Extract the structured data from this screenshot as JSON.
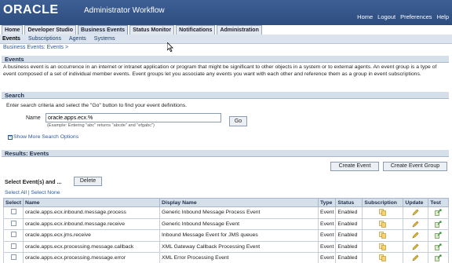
{
  "header": {
    "logo": "ORACLE",
    "app_title": "Administrator Workflow",
    "links": [
      "Home",
      "Logout",
      "Preferences",
      "Help"
    ]
  },
  "tabs": [
    {
      "label": "Home",
      "active": false
    },
    {
      "label": "Developer Studio",
      "active": false
    },
    {
      "label": "Business Events",
      "active": true
    },
    {
      "label": "Status Monitor",
      "active": false
    },
    {
      "label": "Notifications",
      "active": false
    },
    {
      "label": "Administration",
      "active": false
    }
  ],
  "subtabs": [
    {
      "label": "Events",
      "active": true
    },
    {
      "label": "Subscriptions",
      "active": false
    },
    {
      "label": "Agents",
      "active": false
    },
    {
      "label": "Systems",
      "active": false
    }
  ],
  "breadcrumb": "Business Events: Events  >",
  "events_section": {
    "title": "Events",
    "description": "A business event is an occurrence in an internet or intranet application or program that might be significant to other objects in a system or to external agents. An event group is a type of event composed of a set of individual member events. Event groups let you associate any events you want with each other and reference them as a group in event subscriptions."
  },
  "search": {
    "title": "Search",
    "instructions": "Enter search criteria and select the \"Go\" button to find your event definitions.",
    "name_label": "Name",
    "name_value": "oracle.apps.ecx.%",
    "go_label": "Go",
    "example": "(Example: Entering \"abc\" returns \"abcde\" and \"efgabc\")",
    "more_options": "Show More Search Options"
  },
  "results": {
    "title": "Results: Events",
    "create_event": "Create Event",
    "create_event_group": "Create Event Group",
    "select_caption": "Select Event(s) and ...",
    "delete_label": "Delete",
    "select_all": "Select All",
    "select_none": "Select None",
    "columns": [
      "Select",
      "Name",
      "Display Name",
      "Type",
      "Status",
      "Subscription",
      "Update",
      "Test"
    ],
    "rows": [
      {
        "name": "oracle.apps.ecx.inbound.message.process",
        "display": "Generic Inbound Message Process Event",
        "type": "Event",
        "status": "Enabled"
      },
      {
        "name": "oracle.apps.ecx.inbound.message.receive",
        "display": "Generic Inbound Message Event",
        "type": "Event",
        "status": "Enabled"
      },
      {
        "name": "oracle.apps.ecx.jms.receive",
        "display": "Inbound Message Event for JMS queues",
        "type": "Event",
        "status": "Enabled"
      },
      {
        "name": "oracle.apps.ecx.processing.message.callback",
        "display": "XML Gateway Callback Processing Event",
        "type": "Event",
        "status": "Enabled"
      },
      {
        "name": "oracle.apps.ecx.processing.message.error",
        "display": "XML Error Processing Event",
        "type": "Event",
        "status": "Enabled"
      }
    ]
  },
  "colors": {
    "header": "#3d5f94",
    "link": "#2c5aa0",
    "section_bg": "#d5dfea"
  }
}
